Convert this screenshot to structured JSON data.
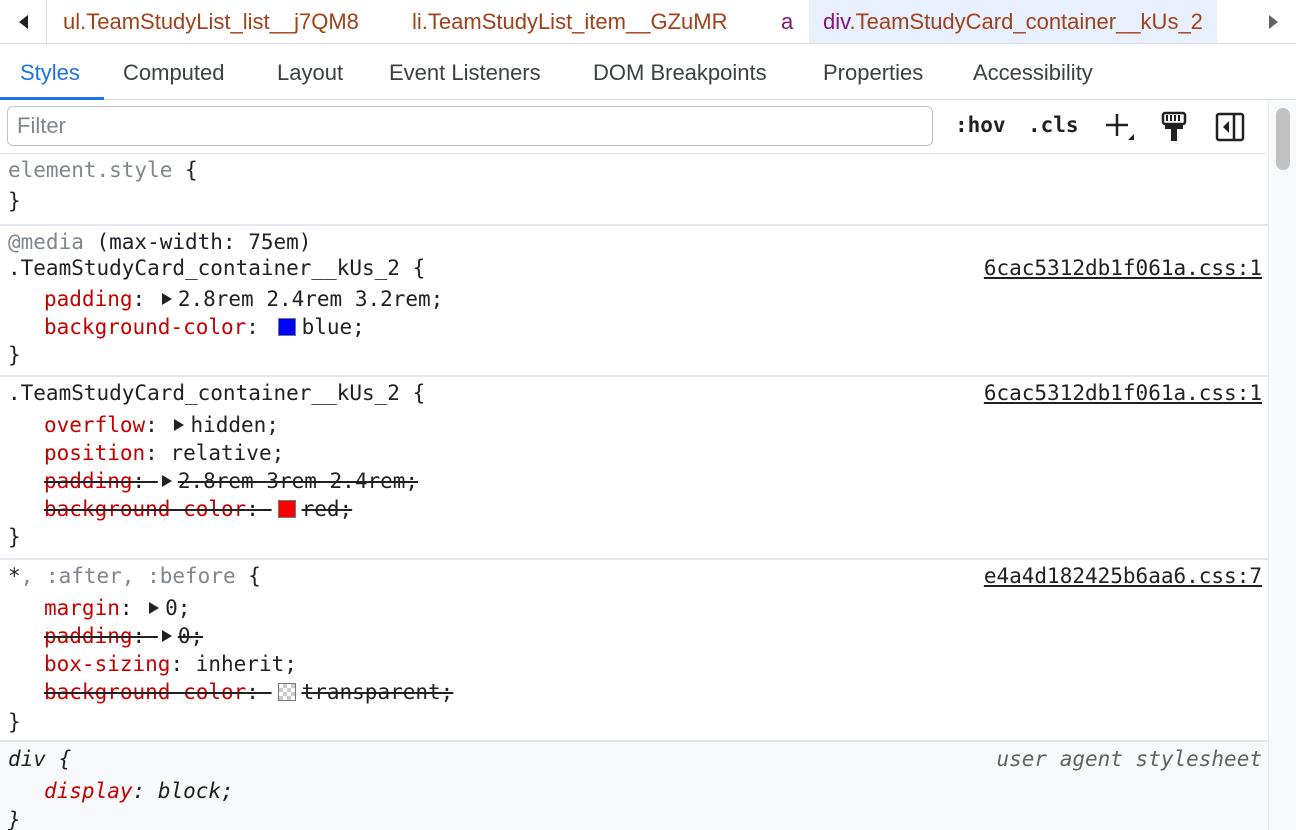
{
  "breadcrumbs": [
    {
      "tag": "ul",
      "cls": ".TeamStudyList_list__j7QM8"
    },
    {
      "tag": "li",
      "cls": ".TeamStudyList_item__GZuMR"
    },
    {
      "tag": "a",
      "cls": ""
    },
    {
      "tag": "div",
      "cls": ".TeamStudyCard_container__kUs_2"
    }
  ],
  "tabs": [
    "Styles",
    "Computed",
    "Layout",
    "Event Listeners",
    "DOM Breakpoints",
    "Properties",
    "Accessibility"
  ],
  "toolbar": {
    "filter_placeholder": "Filter",
    "hov": ":hov",
    "cls": ".cls"
  },
  "rules": {
    "element": {
      "selector": "element.style",
      "open": " {",
      "close": "}"
    },
    "media": {
      "at": "@media",
      "query": " (max-width: 75em)",
      "selector": ".TeamStudyCard_container__kUs_2 {",
      "source": "6cac5312db1f061a.css:1",
      "props": [
        {
          "name": "padding",
          "value": "2.8rem 2.4rem 3.2rem;"
        },
        {
          "name": "background-color",
          "value": "blue;",
          "color": "#0000ff"
        }
      ]
    },
    "container": {
      "selector": ".TeamStudyCard_container__kUs_2 {",
      "source": "6cac5312db1f061a.css:1",
      "props": [
        {
          "name": "overflow",
          "value": "hidden;"
        },
        {
          "name": "position",
          "value": "relative;"
        },
        {
          "name": "padding",
          "value": "2.8rem 3rem 2.4rem;"
        },
        {
          "name": "background-color",
          "value": "red;",
          "color": "#ff0000"
        }
      ]
    },
    "universal": {
      "sel_star": "*",
      "sel_rest": ", :after, :before",
      "open": " {",
      "source": "e4a4d182425b6aa6.css:7",
      "props": [
        {
          "name": "margin",
          "value": "0;"
        },
        {
          "name": "padding",
          "value": "0;"
        },
        {
          "name": "box-sizing",
          "value": "inherit;"
        },
        {
          "name": "background-color",
          "value": "transparent;"
        }
      ]
    },
    "div": {
      "selector": "div {",
      "source": "user agent stylesheet",
      "props": [
        {
          "name": "display",
          "value": "block;"
        }
      ],
      "close": "}"
    }
  },
  "punct": {
    "colon": ": ",
    "close": "}"
  }
}
